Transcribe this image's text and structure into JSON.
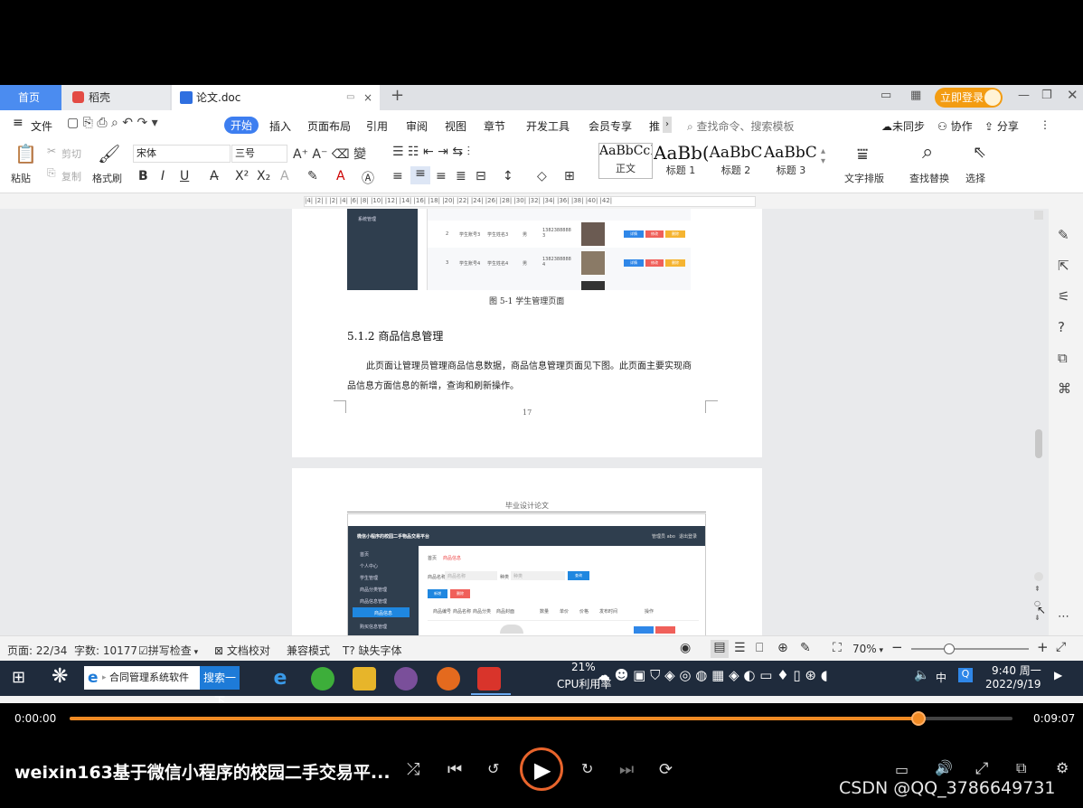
{
  "tabs": {
    "home": "首页",
    "daoke": "稻壳",
    "doc": "论文.doc",
    "add": "+"
  },
  "titlebar": {
    "login_button": "立即登录"
  },
  "menu": {
    "file": "文件",
    "items": [
      "开始",
      "插入",
      "页面布局",
      "引用",
      "审阅",
      "视图",
      "章节",
      "开发工具",
      "会员专享",
      "推"
    ],
    "search_placeholder": "查找命令、搜索模板",
    "sync": "未同步",
    "collab": "协作",
    "share": "分享"
  },
  "ribbon": {
    "paste": "粘贴",
    "cut": "剪切",
    "copy": "复制",
    "format_painter": "格式刷",
    "font_name": "宋体",
    "font_size": "三号",
    "styles": [
      {
        "sample": "AaBbCcI",
        "label": "正文"
      },
      {
        "sample": "AaBb(",
        "label": "标题 1"
      },
      {
        "sample": "AaBbC",
        "label": "标题 2"
      },
      {
        "sample": "AaBbC(",
        "label": "标题 3"
      }
    ],
    "text_layout": "文字排版",
    "find_replace": "查找替换",
    "select": "选择"
  },
  "ruler": {
    "ticks": "|4| |2| |   |2| |4| |6| |8| |10| |12| |14| |16| |18| |20| |22| |24| |26| |28| |30| |32| |34| |36| |38| |40| |42|"
  },
  "document": {
    "figure_caption": "图 5-1 学生管理页面",
    "section_heading": "5.1.2  商品信息管理",
    "paragraph_line1": "此页面让管理员管理商品信息数据，商品信息管理页面见下图。此页面主要实现商",
    "paragraph_line2": "品信息方面信息的新增，查询和刷新操作。",
    "page_number": "17",
    "page2_header": "毕业设计论文",
    "figure1": {
      "sidebar_item": "系统管理",
      "rows": [
        {
          "num": "2",
          "id": "学生账号3",
          "name": "学生姓名3",
          "gender": "男",
          "phone": "1382388888 3"
        },
        {
          "num": "3",
          "id": "学生账号4",
          "name": "学生姓名4",
          "gender": "男",
          "phone": "1382388888 4"
        }
      ],
      "btn_detail": "详情",
      "btn_edit": "修改",
      "btn_delete": "删除"
    },
    "figure2": {
      "app_title": "微信小程序的校园二手物品交易平台",
      "admin": "管理员 abo",
      "logout": "退出登录",
      "sidebar": [
        "首页",
        "个人中心",
        "学生管理",
        "商品分类管理",
        "商品信息管理",
        "商品信息",
        "购买信息管理"
      ],
      "breadcrumb_home": "首页",
      "breadcrumb_current": "商品信息",
      "search_label_name": "商品名称",
      "search_label_name_ph": "商品名称",
      "search_label_type": "种类",
      "search_label_type_ph": "种类",
      "search_button": "查询",
      "add_button": "新增",
      "delete_button": "删除",
      "columns": [
        "商品编号",
        "商品名称",
        "商品分类",
        "商品封面",
        "数量",
        "单价",
        "价格",
        "发布时间",
        "操作"
      ]
    }
  },
  "statusbar": {
    "page": "页面: 22/34",
    "words": "字数: 10177",
    "spell_check": "拼写检查",
    "doc_proof": "文档校对",
    "compat_mode": "兼容模式",
    "missing_font": "缺失字体",
    "zoom": "70%"
  },
  "taskbar": {
    "ie_search_text": "合同管理系统软件",
    "search_button": "搜索一下",
    "cpu_percent": "21%",
    "cpu_label": "CPU利用率",
    "ime": "中",
    "time": "9:40 周一",
    "date": "2022/9/19"
  },
  "player": {
    "current_time": "0:00:00",
    "total_time": "0:09:07",
    "progress": 0.9,
    "title": "weixin163基于微信小程序的校园二手交易平...",
    "watermark": "CSDN @QQ_3786649731"
  },
  "colors": {
    "accent_blue": "#3d7ef0",
    "progress_orange": "#f08a24",
    "taskbar": "#1f2b3c",
    "admin_dark": "#2f3e4e"
  }
}
